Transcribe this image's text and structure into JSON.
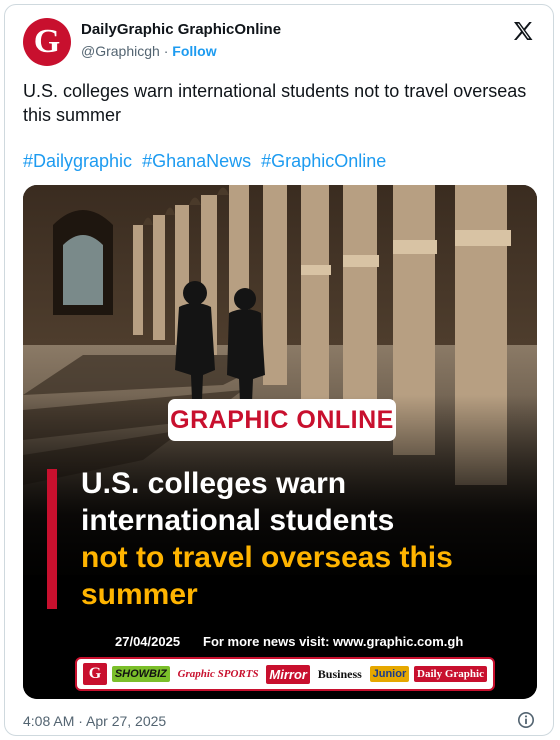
{
  "author": {
    "name": "DailyGraphic GraphicOnline",
    "handle": "@Graphicgh",
    "separator": "·",
    "follow_label": "Follow",
    "avatar_letter": "G"
  },
  "tweet": {
    "text": "U.S. colleges warn international students not to travel overseas this summer",
    "hashtags": [
      "#Dailygraphic",
      "#GhanaNews",
      "#GraphicOnline"
    ],
    "timestamp": "4:08 AM · Apr 27, 2025"
  },
  "media": {
    "brand_label": "GRAPHIC ONLINE",
    "headline_white": [
      "U.S. colleges warn",
      "international students"
    ],
    "headline_yellow": [
      "not to travel overseas this",
      "summer"
    ],
    "date": "27/04/2025",
    "visit_text": "For more news visit: www.graphic.com.gh",
    "publications": [
      "G",
      "SHOWBIZ",
      "Graphic SPORTS",
      "Mirror",
      "Business",
      "Junior",
      "Daily Graphic"
    ]
  },
  "colors": {
    "brand_red": "#c8102e",
    "link_blue": "#1d9bf0",
    "headline_yellow": "#ffb400",
    "muted_text": "#536471"
  },
  "icons": {
    "close": "x-logo-icon",
    "info": "info-icon"
  }
}
